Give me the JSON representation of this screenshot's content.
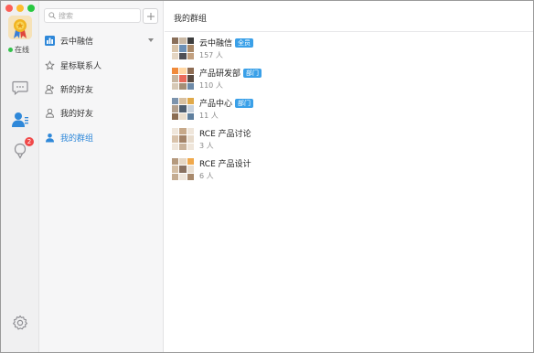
{
  "window": {
    "controls": [
      "close",
      "minimize",
      "maximize"
    ]
  },
  "rail": {
    "status": "在线",
    "status_color": "#33c24a",
    "items": [
      {
        "icon": "chat-bubble-icon",
        "active": false
      },
      {
        "icon": "contacts-icon",
        "active": true
      },
      {
        "icon": "notification-icon",
        "active": false,
        "badge": "2"
      }
    ],
    "settings_icon": "gear-icon"
  },
  "sidebar": {
    "search_placeholder": "搜索",
    "add_icon": "plus-icon",
    "items": [
      {
        "label": "云中融信",
        "icon": "org-icon",
        "expandable": true
      },
      {
        "label": "星标联系人",
        "icon": "star-icon"
      },
      {
        "label": "新的好友",
        "icon": "add-friend-icon"
      },
      {
        "label": "我的好友",
        "icon": "friend-icon"
      },
      {
        "label": "我的群组",
        "icon": "group-icon",
        "active": true
      }
    ]
  },
  "main": {
    "title": "我的群组",
    "groups": [
      {
        "name": "云中融信",
        "tag": "全员",
        "count": "157 人"
      },
      {
        "name": "产品研发部",
        "tag": "部门",
        "count": "110 人"
      },
      {
        "name": "产品中心",
        "tag": "部门",
        "count": "11 人"
      },
      {
        "name": "RCE 产品讨论",
        "tag": "",
        "count": "3 人"
      },
      {
        "name": "RCE 产品设计",
        "tag": "",
        "count": "6 人"
      }
    ]
  },
  "colors": {
    "accent": "#2f88d9",
    "tag": "#3aa0e8",
    "badge": "#f04848"
  }
}
